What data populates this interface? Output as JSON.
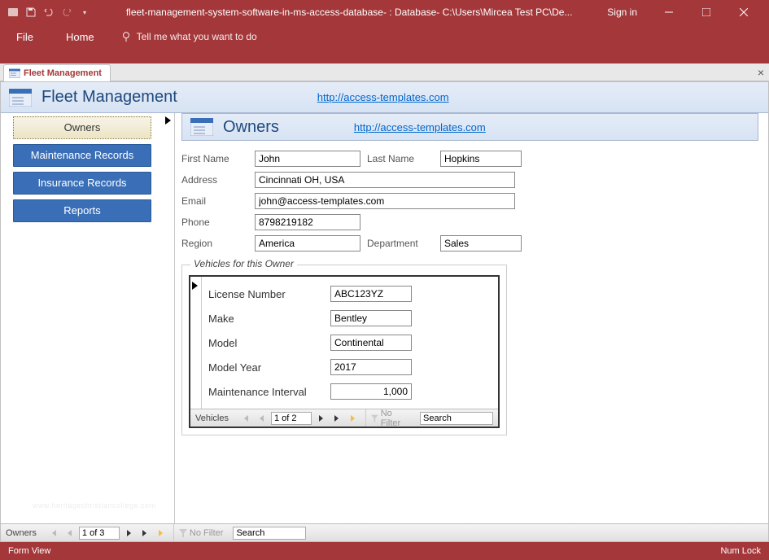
{
  "titlebar": {
    "title": "fleet-management-system-software-in-ms-access-database- : Database- C:\\Users\\Mircea Test PC\\De...",
    "signin": "Sign in"
  },
  "ribbon": {
    "file": "File",
    "home": "Home",
    "tell": "Tell me what you want to do"
  },
  "doctab": {
    "label": "Fleet Management"
  },
  "header": {
    "title": "Fleet Management",
    "link": "http://access-templates.com"
  },
  "sidebar": {
    "items": [
      {
        "label": "Owners",
        "active": true
      },
      {
        "label": "Maintenance Records"
      },
      {
        "label": "Insurance Records"
      },
      {
        "label": "Reports"
      }
    ]
  },
  "subheader": {
    "title": "Owners",
    "link": "http://access-templates.com"
  },
  "owner": {
    "labels": {
      "first_name": "First Name",
      "last_name": "Last Name",
      "address": "Address",
      "email": "Email",
      "phone": "Phone",
      "region": "Region",
      "department": "Department"
    },
    "first_name": "John",
    "last_name": "Hopkins",
    "address": "Cincinnati OH, USA",
    "email": "john@access-templates.com",
    "phone": "8798219182",
    "region": "America",
    "department": "Sales"
  },
  "vehicles": {
    "legend": "Vehicles for this Owner",
    "labels": {
      "license": "License Number",
      "make": "Make",
      "model": "Model",
      "year": "Model Year",
      "interval": "Maintenance Interval"
    },
    "license": "ABC123YZ",
    "make": "Bentley",
    "model": "Continental",
    "year": "2017",
    "interval": "1,000",
    "nav": {
      "name": "Vehicles",
      "pos": "1 of 2",
      "nofilter": "No Filter",
      "search": "Search"
    }
  },
  "mainnav": {
    "name": "Owners",
    "pos": "1 of 3",
    "nofilter": "No Filter",
    "search": "Search"
  },
  "status": {
    "left": "Form View",
    "numlock": "Num Lock"
  },
  "watermark": "www.heritagechristiancollege.com"
}
